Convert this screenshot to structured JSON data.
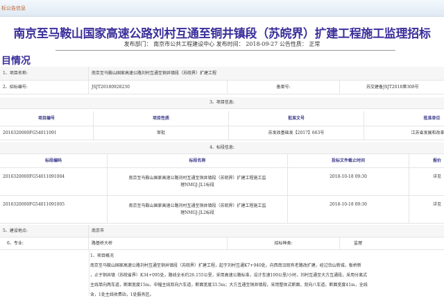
{
  "breadcrumb": "标公告信息",
  "title": "南京至马鞍山国家高速公路刘村互通至铜井镇段（苏皖界）扩建工程施工监理招标",
  "meta": "发布部门： 南京市公共工程建设中心 发布时间： 2018-09-27 公告性质： 正常",
  "section_title": "目情况",
  "project_name": {
    "label": "1、项目名称:",
    "value": "南京至马鞍山国家高速公路刘村互通至铜井镇段（苏皖界）扩建工程"
  },
  "tender_no": {
    "label": "2、招标编号:",
    "value": "JSJT20180928230",
    "record_label": "备案号:",
    "record_value": "苏交建备JSJT2018第308号"
  },
  "project_info": {
    "heading": "3、项目信息:",
    "headers": [
      "项目编号",
      "项目性质",
      "批准文号",
      "批准单位"
    ],
    "row": [
      "2016320000FG54011091",
      "审批",
      "苏发改基础发【2017】663号",
      "江苏省发展和改革委员"
    ]
  },
  "section_info": {
    "heading": "4、标段信息:",
    "headers": [
      "标段编码",
      "标段名称",
      "投标文件截止时间",
      "报价"
    ],
    "rows": [
      [
        "2016320000FG54011091004",
        "南京至马鞍山国家高速公路刘村互通至铜井镇段（苏皖界）扩建工程施工监理NMGJ-JL1标段",
        "2018-10-18 09:30",
        "详见"
      ],
      [
        "2016320000FG54011091005",
        "南京至马鞍山国家高速公路刘村互通至铜井镇段（苏皖界）扩建工程施工监理NMGJ-JL2标段",
        "2018-10-18 09:30",
        "详见"
      ]
    ]
  },
  "location": {
    "label": "5、建设地点:",
    "value": "南京市"
  },
  "major": {
    "label": "6、专业:",
    "value": "路基桥大桥",
    "type_label": "招标种类:",
    "type_value": "监理"
  },
  "desc": [
    "1、项目概况",
    "南京至马鞍山国家高速公路刘村互通至铜井镇段（苏皖界）扩建工程，起于刘村互通K7+940处，向西南沿既有老路改扩建，经过岱山新城，板桥新",
    "，止于铜井镇（苏皖省界）K34+095处，路线全长约26.155公里，采用高速公路标准，设计车速100公里/小时，刘村互通至大方互通段，采用分离式",
    "主线单向两车道，断面宽度15m，中幅主线双向六车道，断面宽度33.5m；大方互通至铜井镇段，采用整体式断面，双向八车道，断面宽度41m，全线",
    "含，1处主线收费站，1处服务区。"
  ]
}
